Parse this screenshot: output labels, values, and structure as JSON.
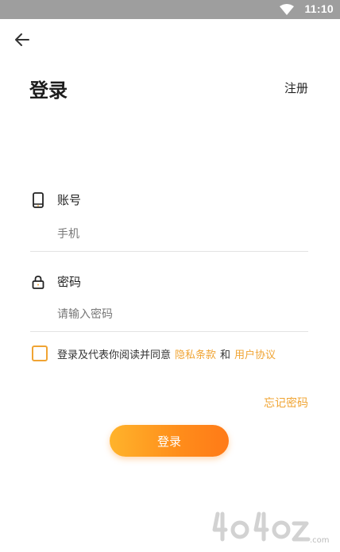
{
  "status_bar": {
    "time": "11:10",
    "wifi_icon": "wifi-icon"
  },
  "header": {
    "back_icon": "arrow-left-icon",
    "title": "登录",
    "register_label": "注册"
  },
  "account": {
    "icon": "phone-icon",
    "label": "账号",
    "placeholder": "手机"
  },
  "password": {
    "icon": "lock-icon",
    "label": "密码",
    "placeholder": "请输入密码"
  },
  "agreement": {
    "text": "登录及代表你阅读并同意",
    "privacy_link": "隐私条款",
    "and": "和",
    "user_agreement_link": "用户协议"
  },
  "forgot_password": "忘记密码",
  "login_button": "登录",
  "colors": {
    "accent": "#f0a433",
    "button_start": "#ffb32b",
    "button_end": "#ff7a18",
    "status_bar": "#9e9e9e"
  },
  "watermark": {
    "text": "4u4oz.com"
  }
}
